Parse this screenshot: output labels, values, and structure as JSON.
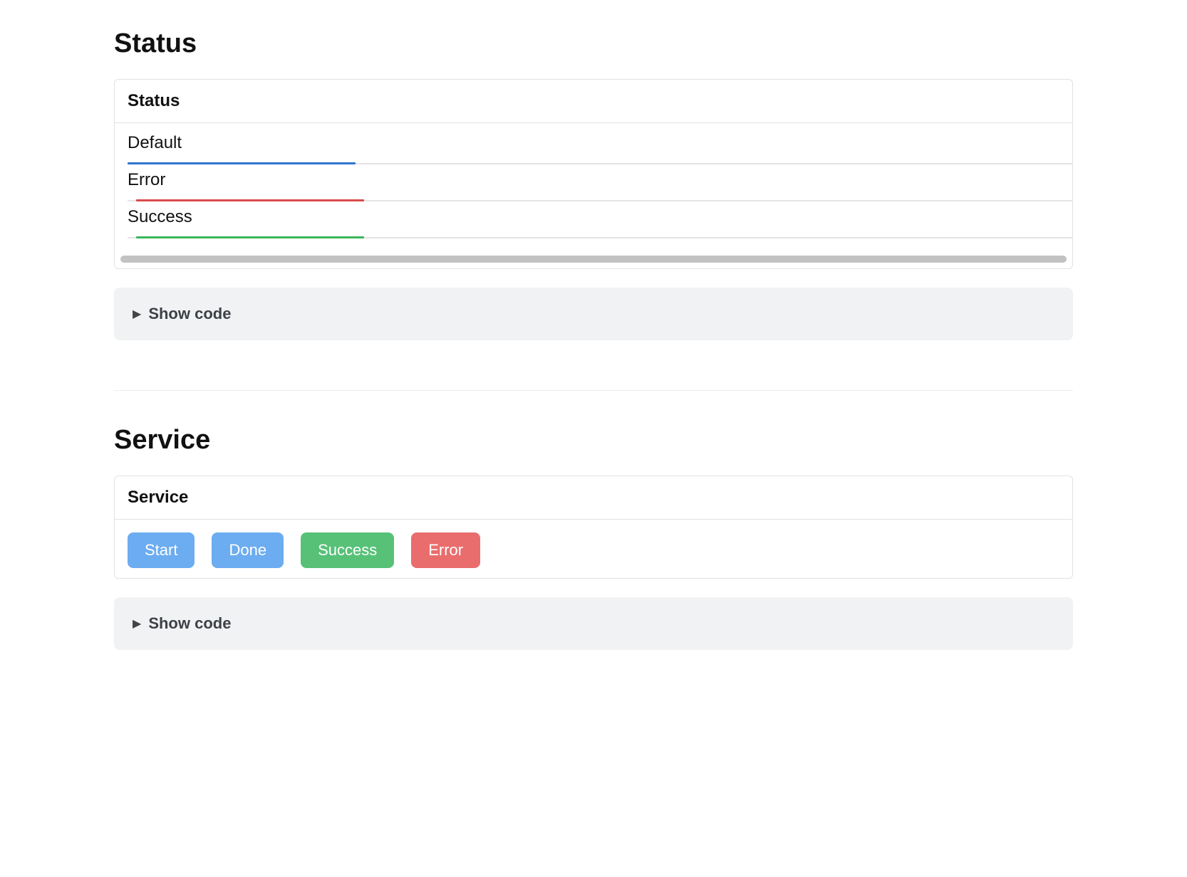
{
  "status_section": {
    "heading": "Status",
    "card_title": "Status",
    "rows": [
      {
        "label": "Default",
        "variant": "default"
      },
      {
        "label": "Error",
        "variant": "error"
      },
      {
        "label": "Success",
        "variant": "success"
      }
    ],
    "show_code_label": "Show code"
  },
  "service_section": {
    "heading": "Service",
    "card_title": "Service",
    "buttons": [
      {
        "label": "Start",
        "variant": "blue"
      },
      {
        "label": "Done",
        "variant": "blue"
      },
      {
        "label": "Success",
        "variant": "green"
      },
      {
        "label": "Error",
        "variant": "red"
      }
    ],
    "show_code_label": "Show code"
  },
  "colors": {
    "default": "#2f74d0",
    "error": "#d94b4b",
    "success": "#3cb659",
    "btn_blue": "#6cacf0",
    "btn_green": "#57c178",
    "btn_red": "#ea6d6d"
  }
}
